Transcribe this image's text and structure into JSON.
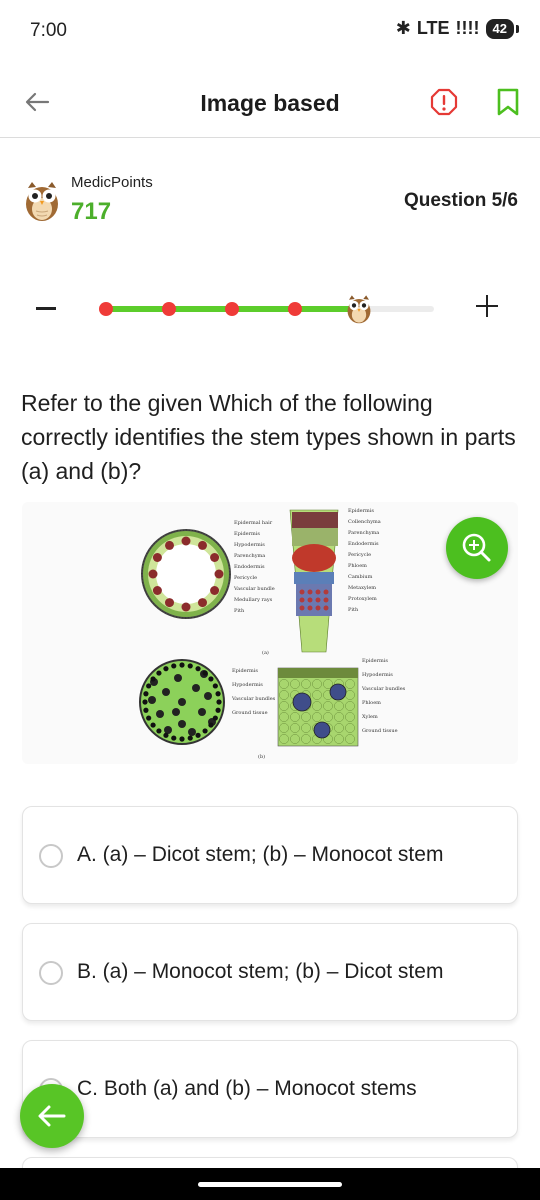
{
  "status": {
    "time": "7:00",
    "network": "LTE",
    "battery": "42"
  },
  "header": {
    "title": "Image based"
  },
  "points": {
    "label": "MedicPoints",
    "value": "717"
  },
  "question": {
    "counter": "Question 5/6",
    "text": "Refer to the given Which of the following correctly identifies the stem types shown in parts (a) and (b)?"
  },
  "progress": {
    "completed_dots": 4,
    "total_dots": 6,
    "fraction": 0.77
  },
  "figure": {
    "labels_a_left": [
      "Epidermal hair",
      "Epidermis",
      "Hypodermis",
      "Parenchyma",
      "Endodermis",
      "Pericycle",
      "Vascular bundle",
      "Medullary rays",
      "Pith"
    ],
    "labels_a_right": [
      "Epidermis",
      "Collenchyma",
      "Parenchyma",
      "Endodermis",
      "Pericycle",
      "Phloem",
      "Cambium",
      "Metaxylem",
      "Protoxylem",
      "Pith"
    ],
    "caption_a": "(a)",
    "labels_b_left": [
      "Epidermis",
      "Hypodermis",
      "Vascular bundles",
      "Ground tissue"
    ],
    "labels_b_right": [
      "Epidermis",
      "Hypodermis",
      "Vascular bundles",
      "Phloem",
      "Xylem",
      "Ground tissue"
    ],
    "caption_b": "(b)"
  },
  "options": [
    {
      "text": "A. (a) – Dicot stem; (b) – Monocot stem"
    },
    {
      "text": "B. (a) – Monocot stem; (b) – Dicot stem"
    },
    {
      "text": "C. Both (a) and (b) – Monocot stems"
    }
  ],
  "colors": {
    "accent_green": "#4cbf1f",
    "points_green": "#4caf2b",
    "dot_red": "#ef3b38",
    "report_red": "#e53935"
  }
}
